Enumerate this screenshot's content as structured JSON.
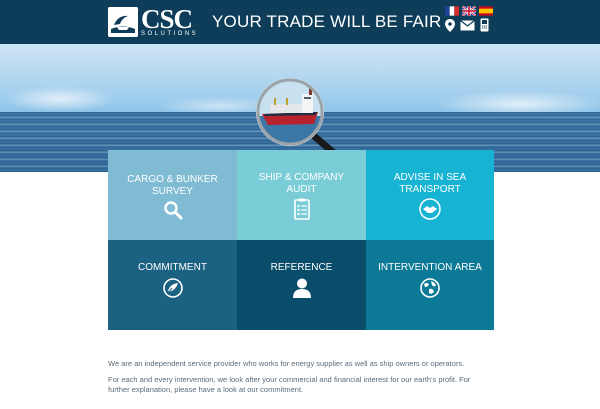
{
  "header": {
    "logo_text": "CSC",
    "logo_subtext": "SOLUTIONS",
    "tagline": "YOUR TRADE WILL BE FAIR",
    "languages": [
      "French",
      "English",
      "Spanish"
    ],
    "contact_icons": [
      "location-icon",
      "mail-icon",
      "phone-icon"
    ]
  },
  "services": [
    {
      "label": "CARGO & BUNKER SURVEY",
      "icon": "search-icon",
      "color": "#7fbcd3"
    },
    {
      "label": "SHIP & COMPANY AUDIT",
      "icon": "checklist-icon",
      "color": "#7acdd6"
    },
    {
      "label": "ADVISE IN SEA TRANSPORT",
      "icon": "handshake-icon",
      "color": "#16b3d3"
    },
    {
      "label": "COMMITMENT",
      "icon": "globe-leaf-icon",
      "color": "#1a6182"
    },
    {
      "label": "REFERENCE",
      "icon": "person-icon",
      "color": "#0a4d6b"
    },
    {
      "label": "INTERVENTION AREA",
      "icon": "globe-icon",
      "color": "#0c7a96"
    }
  ],
  "intro": {
    "paragraph_1": "We are an independent service provider who works for energy supplier as well as ship owners or operators.",
    "paragraph_2": "For each and every intervention, we look after your commercial and financial interest for our earth's profit. For further explanation, please have a look at our commitment."
  },
  "colors": {
    "header_bg": "#0d3d59",
    "body_text": "#5a6b79"
  }
}
